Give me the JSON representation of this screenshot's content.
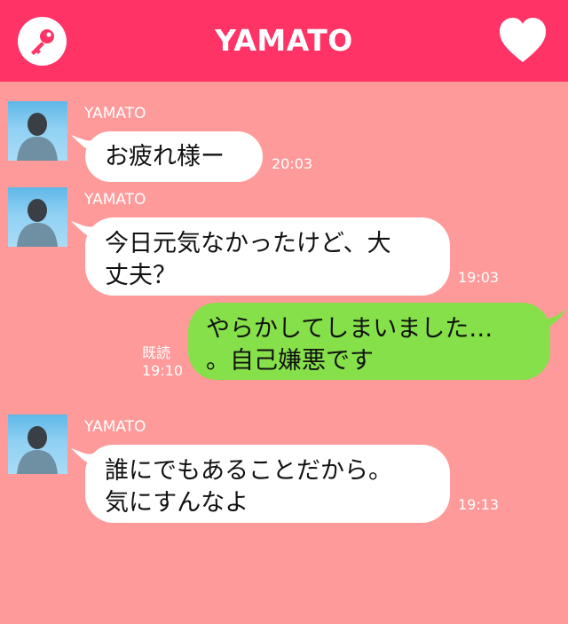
{
  "header": {
    "title": "YAMATO"
  },
  "messages": [
    {
      "sender": "YAMATO",
      "text": "お疲れ様ー",
      "time": "20:03"
    },
    {
      "sender": "YAMATO",
      "line1": "今日元気なかったけど、大",
      "line2": "丈夫？",
      "time": "19:03"
    },
    {
      "read": "既読",
      "time": "19:10",
      "line1": "やらかしてしまいました…",
      "line2": "。自己嫌悪です"
    },
    {
      "sender": "YAMATO",
      "line1": "誰にでもあることだから。",
      "line2": "気にすんなよ",
      "time": "19:13"
    }
  ],
  "colors": {
    "header": "#ff3366",
    "background": "#ff9a9a",
    "incoming_bubble": "#ffffff",
    "outgoing_bubble": "#86e04a"
  },
  "icons": {
    "left": "key-icon",
    "right": "heart-icon",
    "avatar": "person-photo"
  }
}
